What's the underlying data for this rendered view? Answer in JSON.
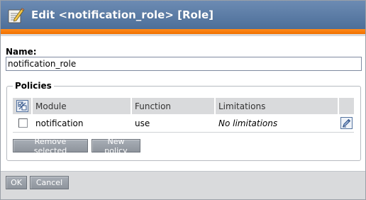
{
  "window": {
    "title": "Edit <notification_role> [Role]"
  },
  "form": {
    "name_label": "Name:",
    "name_value": "notification_role"
  },
  "policies": {
    "legend": "Policies",
    "columns": {
      "module": "Module",
      "function": "Function",
      "limitations": "Limitations"
    },
    "rows": [
      {
        "module": "notification",
        "function": "use",
        "limitations": "No limitations"
      }
    ],
    "remove_label": "Remove selected",
    "new_label": "New policy"
  },
  "footer": {
    "ok_label": "OK",
    "cancel_label": "Cancel"
  },
  "icons": {
    "title": "edit-notepad-icon",
    "toggle_selection": "toggle-selection-icon",
    "edit": "edit-pencil-icon"
  },
  "colors": {
    "titlebar": "#5a7ba6",
    "accent": "#f07000",
    "button": "#9aa0a8",
    "grid_header": "#d9dadc"
  }
}
